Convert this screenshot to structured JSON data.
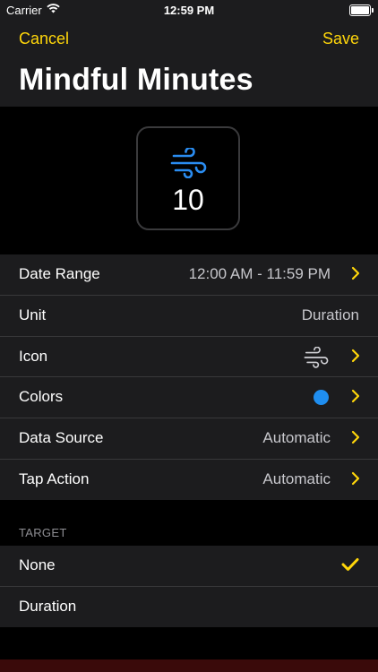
{
  "status_bar": {
    "carrier": "Carrier",
    "time": "12:59 PM"
  },
  "nav": {
    "cancel_label": "Cancel",
    "save_label": "Save",
    "title": "Mindful Minutes"
  },
  "preview": {
    "icon": "wind-icon",
    "value": "10",
    "icon_color": "#2a8cf0"
  },
  "settings": {
    "date_range": {
      "label": "Date Range",
      "value": "12:00 AM - 11:59 PM"
    },
    "unit": {
      "label": "Unit",
      "value": "Duration"
    },
    "icon": {
      "label": "Icon",
      "icon": "wind-icon"
    },
    "colors": {
      "label": "Colors",
      "color": "#1f8ef0"
    },
    "data_source": {
      "label": "Data Source",
      "value": "Automatic"
    },
    "tap_action": {
      "label": "Tap Action",
      "value": "Automatic"
    }
  },
  "target": {
    "header": "TARGET",
    "options": [
      {
        "label": "None",
        "selected": true
      },
      {
        "label": "Duration",
        "selected": false
      }
    ]
  },
  "colors": {
    "accent": "#ffd60a",
    "background": "#000000",
    "cell": "#1c1c1e"
  }
}
